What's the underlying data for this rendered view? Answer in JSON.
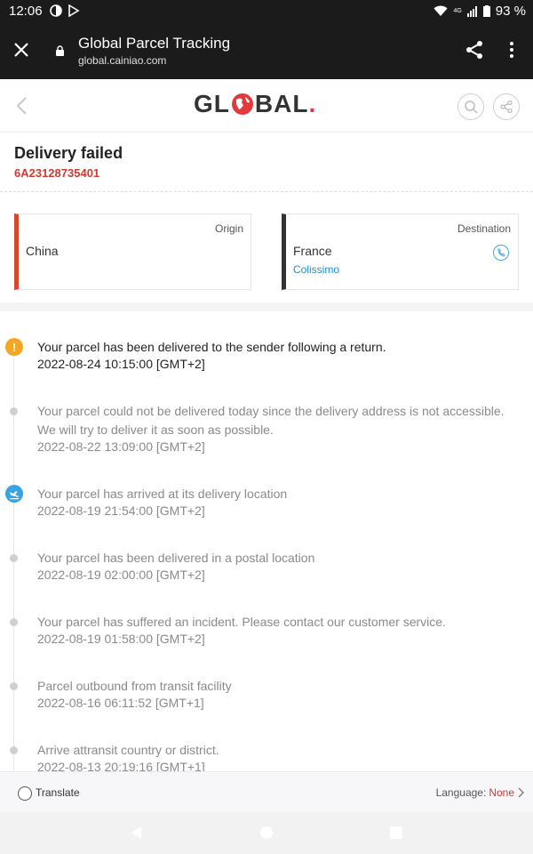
{
  "status_bar": {
    "time": "12:06",
    "battery": "93 %",
    "network": "4G"
  },
  "browser": {
    "title": "Global Parcel Tracking",
    "url": "global.cainiao.com",
    "icons": [
      "close-icon",
      "lock-icon",
      "share-icon",
      "more-vert-icon"
    ]
  },
  "site_header": {
    "logo_prefix": "GL",
    "logo_suffix": "BAL",
    "logo_dot": "."
  },
  "shipment": {
    "status": "Delivery failed",
    "tracking_number": "6A23128735401"
  },
  "route": {
    "origin": {
      "tag": "Origin",
      "country": "China",
      "bar_color": "#d9472b"
    },
    "destination": {
      "tag": "Destination",
      "country": "France",
      "carrier": "Colissimo",
      "bar_color": "#333333"
    }
  },
  "events": [
    {
      "description": "Your parcel has been delivered to the sender following a return.",
      "time": "2022-08-24 10:15:00 [GMT+2]",
      "icon": "warning-icon"
    },
    {
      "description": "Your parcel could not be delivered today since the delivery address is not accessible. We will try to deliver it as soon as possible.",
      "time": "2022-08-22 13:09:00 [GMT+2]",
      "icon": "dot"
    },
    {
      "description": "Your parcel has arrived at its delivery location",
      "time": "2022-08-19 21:54:00 [GMT+2]",
      "icon": "plane-landing-icon"
    },
    {
      "description": "Your parcel has been delivered in a postal location",
      "time": "2022-08-19 02:00:00 [GMT+2]",
      "icon": "dot"
    },
    {
      "description": "Your parcel has suffered an incident. Please contact our customer service.",
      "time": "2022-08-19 01:58:00 [GMT+2]",
      "icon": "dot"
    },
    {
      "description": "Parcel outbound from transit facility",
      "time": "2022-08-16 06:11:52 [GMT+1]",
      "icon": "dot"
    },
    {
      "description": "Arrive attransit country or district.",
      "time": "2022-08-13 20:19:16 [GMT+1]",
      "icon": "dot"
    }
  ],
  "translate_bar": {
    "label": "Translate",
    "language_label": "Language:",
    "language_value": "None"
  },
  "colors": {
    "accent_red": "#d03a2f",
    "link_blue": "#1a8fd6",
    "warning_orange": "#f5a623",
    "plane_blue": "#3aa3e6"
  }
}
